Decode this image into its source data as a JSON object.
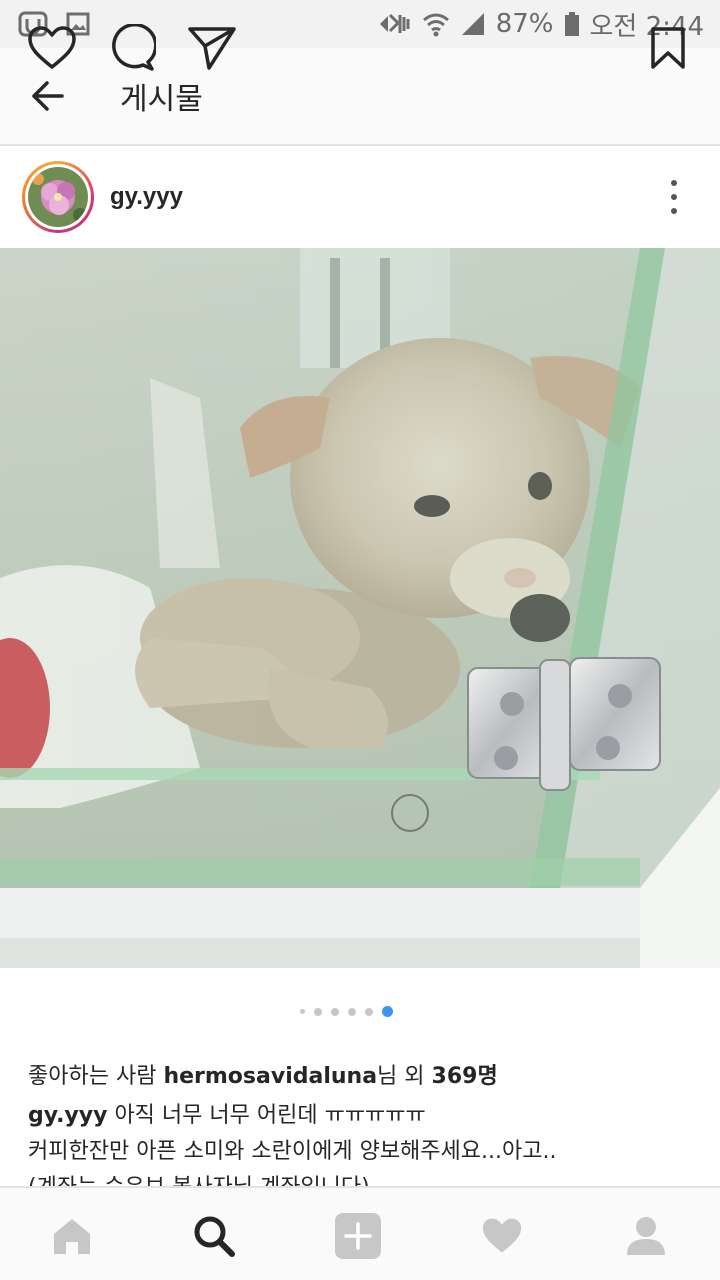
{
  "status_bar": {
    "battery": "87%",
    "time": "오전 2:44",
    "icons": [
      "screen-mirror-icon",
      "gallery-icon",
      "mute-icon",
      "wifi-icon",
      "signal-icon",
      "battery-icon"
    ]
  },
  "app_bar": {
    "title": "게시물",
    "back_icon": "back-arrow-icon"
  },
  "post": {
    "username": "gy.yyy",
    "more_icon": "more-vertical-icon",
    "photo_description": "puppy-in-glass-kennel",
    "carousel": {
      "count": 6,
      "active_index": 5
    },
    "actions": [
      "heart-icon",
      "comment-icon",
      "share-icon",
      "bookmark-icon"
    ],
    "likes_prefix": "좋아하는 사람 ",
    "likes_user": "hermosavidaluna",
    "likes_mid": "님 외 ",
    "likes_count": "369명",
    "caption_user": "gy.yyy",
    "caption_line1": " 아직 너무 너무 어린데 ㅠㅠㅠㅠㅠ",
    "caption_line2": "커피한잔만 아픈 소미와 소란이에게 양보해주세요...아고..",
    "caption_line3": "(계좌는 순유보 봉사자님 계좌입니다)"
  },
  "bottom_nav": {
    "items": [
      "home-icon",
      "search-icon",
      "add-icon",
      "activity-heart-icon",
      "profile-icon"
    ],
    "active": "search-icon"
  },
  "colors": {
    "accent_blue": "#3897f0",
    "text": "#262626",
    "icon_inactive": "#c7c7c7"
  }
}
